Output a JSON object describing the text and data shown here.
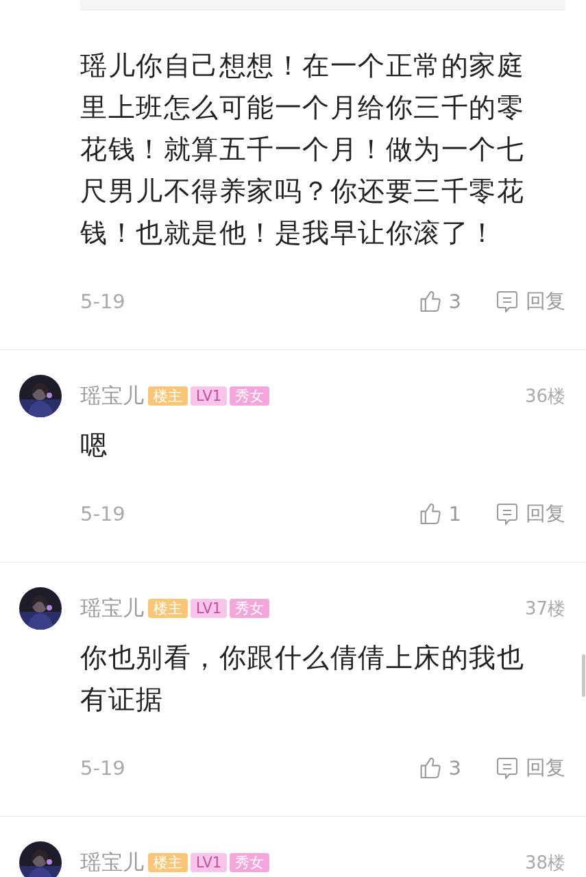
{
  "comments": [
    {
      "body": "瑶儿你自己想想！在一个正常的家庭里上班怎么可能一个月给你三千的零花钱！就算五千一个月！做为一个七尺男儿不得养家吗？你还要三千零花钱！也就是他！是我早让你滚了！",
      "date": "5-19",
      "likes": "3",
      "reply": "回复"
    },
    {
      "author": {
        "name": "瑶宝儿",
        "badges": [
          {
            "label": "楼主",
            "color": "#f8c678"
          },
          {
            "label": "LV1",
            "color": "#f7c5ea"
          },
          {
            "label": "秀女",
            "color": "#f3a6dc"
          }
        ]
      },
      "floor": "36楼",
      "body": "嗯",
      "date": "5-19",
      "likes": "1",
      "reply": "回复"
    },
    {
      "author": {
        "name": "瑶宝儿",
        "badges": [
          {
            "label": "楼主",
            "color": "#f8c678"
          },
          {
            "label": "LV1",
            "color": "#f7c5ea"
          },
          {
            "label": "秀女",
            "color": "#f3a6dc"
          }
        ]
      },
      "floor": "37楼",
      "body": "你也别看，你跟什么倩倩上床的我也有证据",
      "date": "5-19",
      "likes": "3",
      "reply": "回复"
    },
    {
      "author": {
        "name": "瑶宝儿",
        "badges": [
          {
            "label": "楼主",
            "color": "#f8c678"
          },
          {
            "label": "LV1",
            "color": "#f7c5ea"
          },
          {
            "label": "秀女",
            "color": "#f3a6dc"
          }
        ]
      },
      "floor": "38楼"
    }
  ]
}
